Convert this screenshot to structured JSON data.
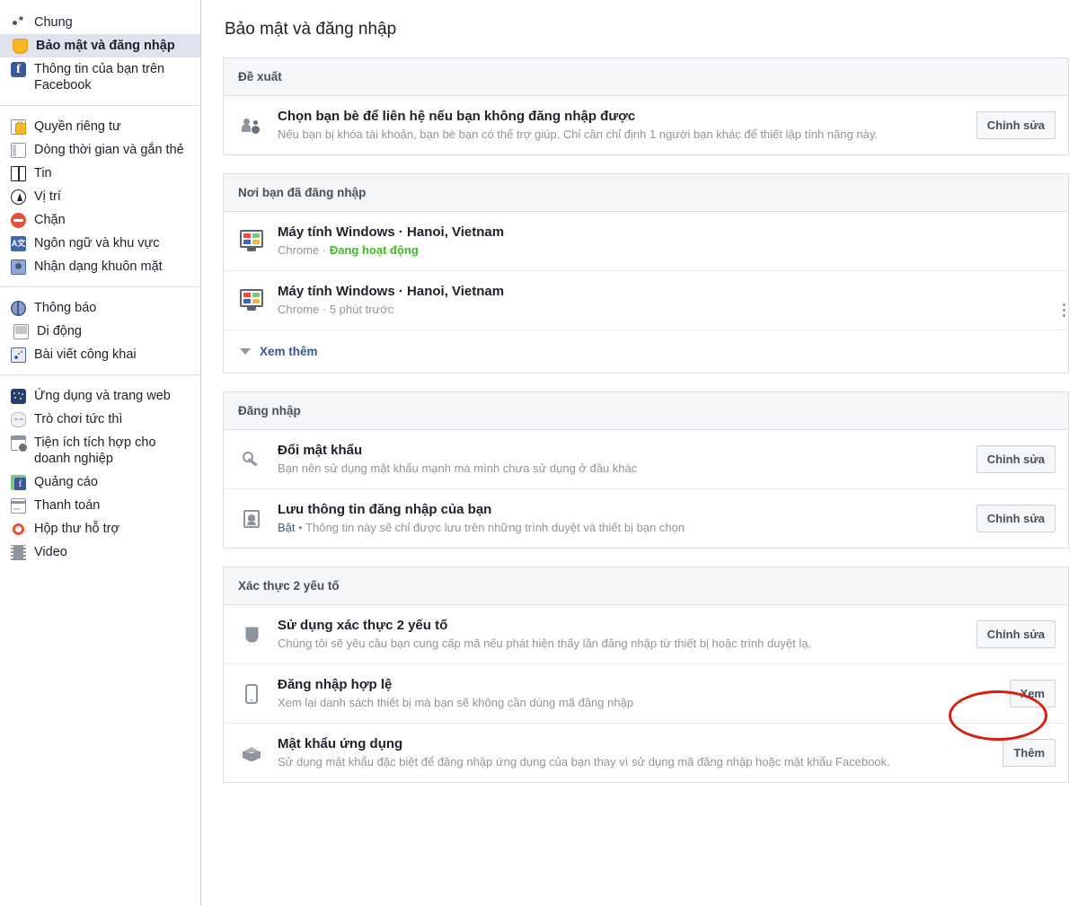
{
  "page": {
    "title": "Bảo mật và đăng nhập"
  },
  "sidebar": {
    "groups": [
      {
        "items": [
          {
            "label": "Chung",
            "icon": "gears-icon",
            "active": false
          },
          {
            "label": "Bảo mật và đăng nhập",
            "icon": "shield-yellow-icon",
            "active": true
          },
          {
            "label": "Thông tin của bạn trên Facebook",
            "icon": "facebook-icon",
            "active": false
          }
        ]
      },
      {
        "items": [
          {
            "label": "Quyền riêng tư",
            "icon": "lock-icon",
            "active": false
          },
          {
            "label": "Dòng thời gian và gắn thẻ",
            "icon": "timeline-icon",
            "active": false
          },
          {
            "label": "Tin",
            "icon": "book-icon",
            "active": false
          },
          {
            "label": "Vị trí",
            "icon": "location-icon",
            "active": false
          },
          {
            "label": "Chặn",
            "icon": "block-icon",
            "active": false
          },
          {
            "label": "Ngôn ngữ và khu vực",
            "icon": "language-icon",
            "active": false
          },
          {
            "label": "Nhận dạng khuôn mặt",
            "icon": "face-recognition-icon",
            "active": false
          }
        ]
      },
      {
        "items": [
          {
            "label": "Thông báo",
            "icon": "globe-icon",
            "active": false
          },
          {
            "label": "Di động",
            "icon": "mobile-icon",
            "active": false
          },
          {
            "label": "Bài viết công khai",
            "icon": "rss-icon",
            "active": false
          }
        ]
      },
      {
        "items": [
          {
            "label": "Ứng dụng và trang web",
            "icon": "apps-icon",
            "active": false
          },
          {
            "label": "Trò chơi tức thì",
            "icon": "gamepad-icon",
            "active": false
          },
          {
            "label": "Tiện ích tích hợp cho doanh nghiệp",
            "icon": "business-integration-icon",
            "active": false
          },
          {
            "label": "Quảng cáo",
            "icon": "ads-icon",
            "active": false
          },
          {
            "label": "Thanh toán",
            "icon": "payment-icon",
            "active": false
          },
          {
            "label": "Hộp thư hỗ trợ",
            "icon": "lifebuoy-icon",
            "active": false
          },
          {
            "label": "Video",
            "icon": "video-icon",
            "active": false
          }
        ]
      }
    ]
  },
  "cards": [
    {
      "name": "recommended",
      "header": "Đề xuất",
      "rows": [
        {
          "name": "trusted-contacts",
          "icon": "friends-icon",
          "title": "Chọn bạn bè để liên hệ nếu bạn không đăng nhập được",
          "sub": "Nếu bạn bị khóa tài khoản, bạn bè bạn có thể trợ giúp. Chỉ cần chỉ định 1 người bạn khác để thiết lập tính năng này.",
          "action": "Chỉnh sửa"
        }
      ]
    },
    {
      "name": "where-logged-in",
      "header": "Nơi bạn đã đăng nhập",
      "rows": [
        {
          "name": "session-1",
          "icon": "windows-computer-icon",
          "title": "Máy tính Windows · Hanoi, Vietnam",
          "browser": "Chrome",
          "separator": "·",
          "status": "Đang hoạt động",
          "status_active": true
        },
        {
          "name": "session-2",
          "icon": "windows-computer-icon",
          "title": "Máy tính Windows · Hanoi, Vietnam",
          "browser": "Chrome",
          "separator": "·",
          "status": "5 phút trước",
          "status_active": false,
          "menu": "kebab-menu-icon"
        }
      ],
      "see_more": "Xem thêm"
    },
    {
      "name": "login",
      "header": "Đăng nhập",
      "rows": [
        {
          "name": "change-password",
          "icon": "key-icon",
          "title": "Đổi mật khẩu",
          "sub": "Bạn nên sử dụng mật khẩu mạnh mà mình chưa sử dụng ở đâu khác",
          "action": "Chỉnh sửa"
        },
        {
          "name": "save-login-info",
          "icon": "id-card-icon",
          "title": "Lưu thông tin đăng nhập của bạn",
          "state": "Bật",
          "sub": "• Thông tin này sẽ chỉ được lưu trên những trình duyệt và thiết bị bạn chọn",
          "action": "Chỉnh sửa"
        }
      ]
    },
    {
      "name": "two-factor",
      "header": "Xác thực 2 yếu tố",
      "rows": [
        {
          "name": "use-two-factor",
          "icon": "shield-icon",
          "title": "Sử dụng xác thực 2 yếu tố",
          "sub": "Chúng tôi sẽ yêu cầu bạn cung cấp mã nếu phát hiện thấy lần đăng nhập từ thiết bị hoặc trình duyệt lạ.",
          "action": "Chỉnh sửa",
          "highlighted": true
        },
        {
          "name": "authorized-logins",
          "icon": "phone-icon",
          "title": "Đăng nhập hợp lệ",
          "sub": "Xem lại danh sách thiết bị mà bạn sẽ không cần dùng mã đăng nhập",
          "action": "Xem"
        },
        {
          "name": "app-passwords",
          "icon": "cube-icon",
          "title": "Mật khẩu ứng dụng",
          "sub": "Sử dụng mật khẩu đặc biệt để đăng nhập ứng dụng của bạn thay vì sử dụng mã đăng nhập hoặc mật khẩu Facebook.",
          "action": "Thêm"
        }
      ]
    }
  ],
  "annotation": {
    "name": "red-ellipse-highlight",
    "color": "#d91f11",
    "target": "Chỉnh sửa"
  },
  "colors": {
    "accent": "#365899",
    "active_green": "#42b72a",
    "sidebar_active_bg": "#dfe3ee",
    "card_header_bg": "#f5f6f7",
    "border": "#dddfe2"
  }
}
